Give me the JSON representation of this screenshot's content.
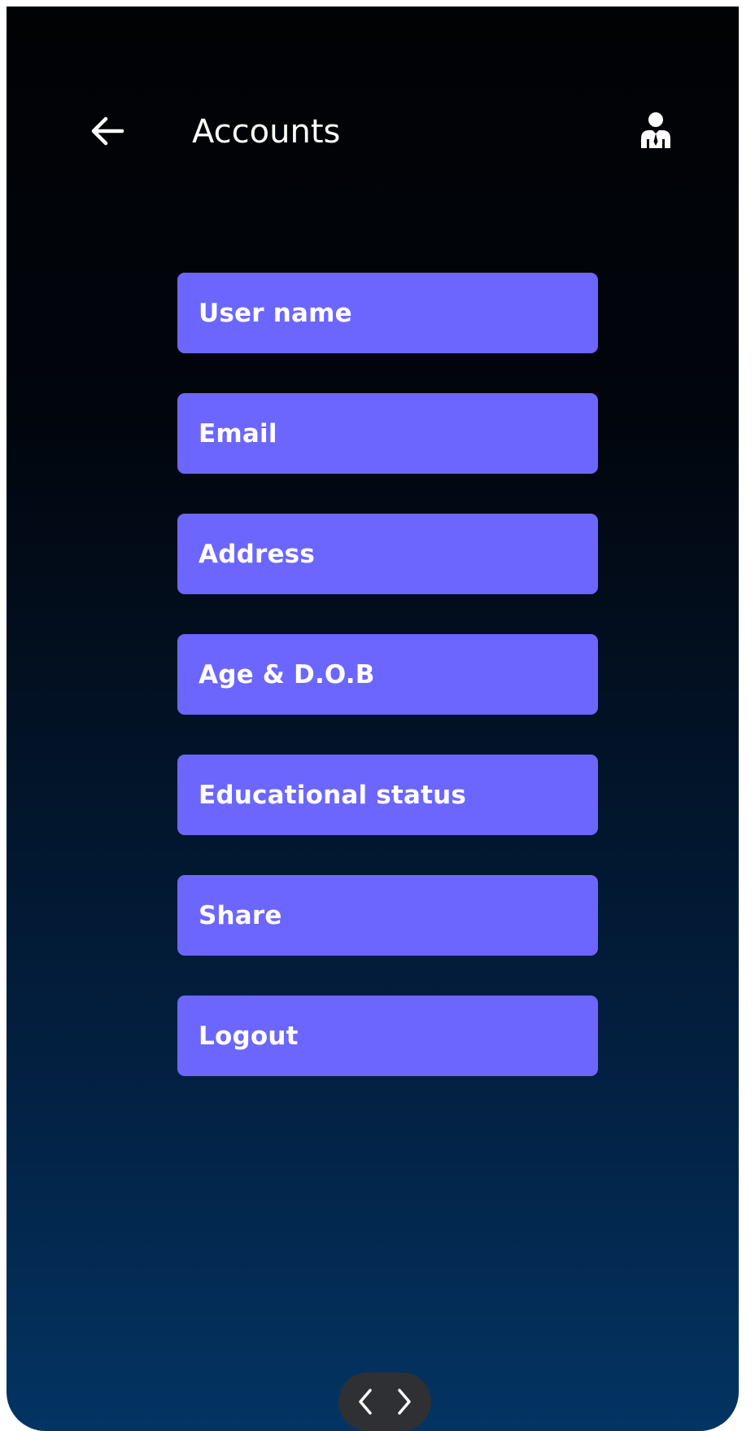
{
  "header": {
    "title": "Accounts",
    "back_icon": "arrow-left-icon",
    "profile_icon": "user-tie-icon"
  },
  "menu": {
    "items": [
      {
        "label": "User name"
      },
      {
        "label": "Email"
      },
      {
        "label": "Address"
      },
      {
        "label": "Age & D.O.B"
      },
      {
        "label": "Educational status"
      },
      {
        "label": "Share"
      },
      {
        "label": "Logout"
      }
    ]
  },
  "bottom_nav": {
    "prev_icon": "chevron-left-icon",
    "next_icon": "chevron-right-icon"
  },
  "colors": {
    "button_fill": "#6c66ff",
    "text": "#ffffff",
    "background_top": "#010204",
    "background_bottom": "#033463",
    "nav_pill": "#2f3033"
  }
}
